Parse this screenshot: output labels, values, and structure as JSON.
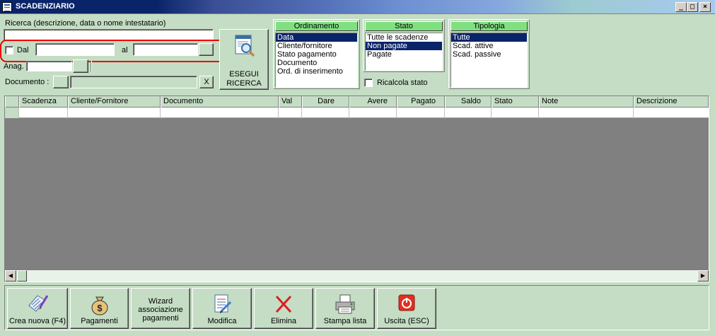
{
  "window": {
    "title": "SCADENZIARIO",
    "controls": [
      "_",
      "□",
      "×"
    ]
  },
  "search": {
    "label": "Ricerca (descrizione, data o nome intestatario)",
    "value": "",
    "dal_label": "Dal",
    "dal_checked": false,
    "dal_value": "",
    "al_label": "al",
    "al_value": "",
    "anag_label": "Anag.",
    "anag_value": "",
    "documento_label": "Documento :",
    "documento_value": "",
    "clear_label": "X",
    "execute_label_1": "ESEGUI",
    "execute_label_2": "RICERCA"
  },
  "ordinamento": {
    "title": "Ordinamento",
    "items": [
      "Data",
      "Cliente/fornitore",
      "Stato pagamento",
      "Documento",
      "Ord. di inserimento"
    ],
    "selected": 0
  },
  "stato": {
    "title": "Stato",
    "items": [
      "Tutte le scadenze",
      "Non pagate",
      "Pagate"
    ],
    "selected": 1,
    "ricalcola_label": "Ricalcola stato",
    "ricalcola_checked": false
  },
  "tipologia": {
    "title": "Tipologia",
    "items": [
      "Tutte",
      "Scad. attive",
      "Scad. passive"
    ],
    "selected": 0
  },
  "grid": {
    "columns": [
      "Scadenza",
      "Cliente/Fornitore",
      "Documento",
      "Val",
      "Dare",
      "Avere",
      "Pagato",
      "Saldo",
      "Stato",
      "Note",
      "Descrizione"
    ],
    "rows": []
  },
  "toolbar": {
    "crea": "Crea nuova (F4)",
    "pagamenti": "Pagamenti",
    "wizard_1": "Wizard",
    "wizard_2": "associazione",
    "wizard_3": "pagamenti",
    "modifica": "Modifica",
    "elimina": "Elimina",
    "stampa": "Stampa lista",
    "uscita": "Uscita (ESC)"
  },
  "colors": {
    "background": "#c4ddc4",
    "panel_header": "#80e080",
    "selection": "#0a246a",
    "highlight_border": "#e00000",
    "grid_empty": "#808080"
  }
}
